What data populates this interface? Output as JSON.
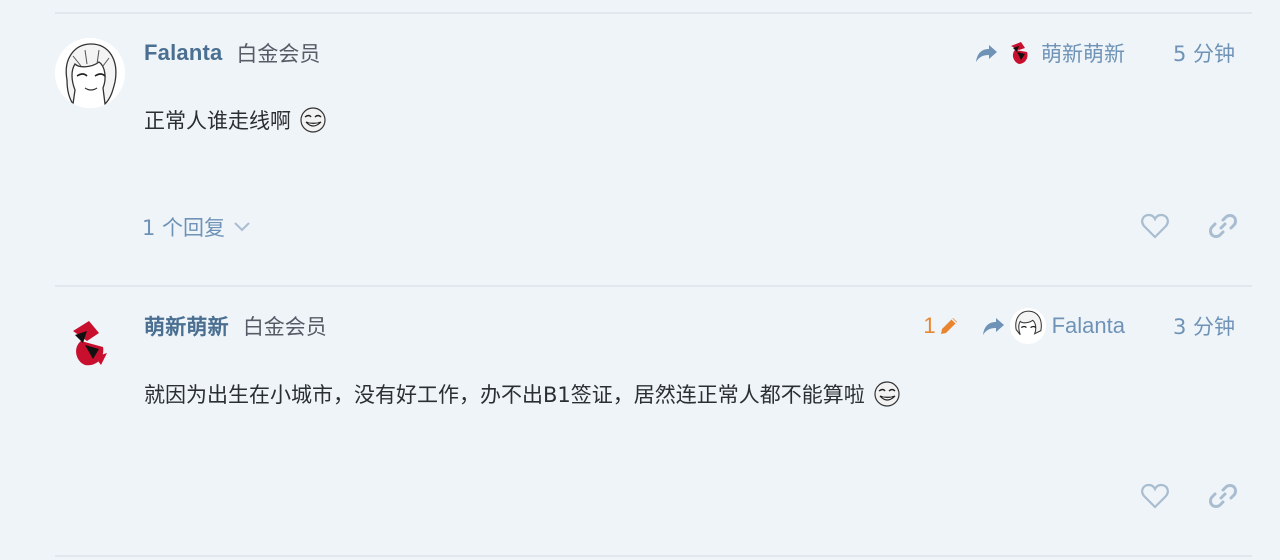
{
  "posts": [
    {
      "username": "Falanta",
      "user_title": "白金会员",
      "reply_to": "萌新萌新",
      "timestamp": "5 分钟",
      "body": "正常人谁走线啊",
      "replies_label": "1 个回复"
    },
    {
      "username": "萌新萌新",
      "user_title": "白金会员",
      "edit_count": "1",
      "reply_to": "Falanta",
      "timestamp": "3 分钟",
      "body": "就因为出生在小城市，没有好工作，办不出B1签证，居然连正常人都不能算啦"
    }
  ],
  "colors": {
    "background": "#eff4f9",
    "username": "#4a6f91",
    "meta": "#6f93b6",
    "edit": "#e8852e",
    "icon": "#a9bdd0"
  },
  "icons": [
    "reply-arrow-icon",
    "pencil-icon",
    "heart-icon",
    "link-icon",
    "chevron-down-icon",
    "troll-face-emoji"
  ]
}
